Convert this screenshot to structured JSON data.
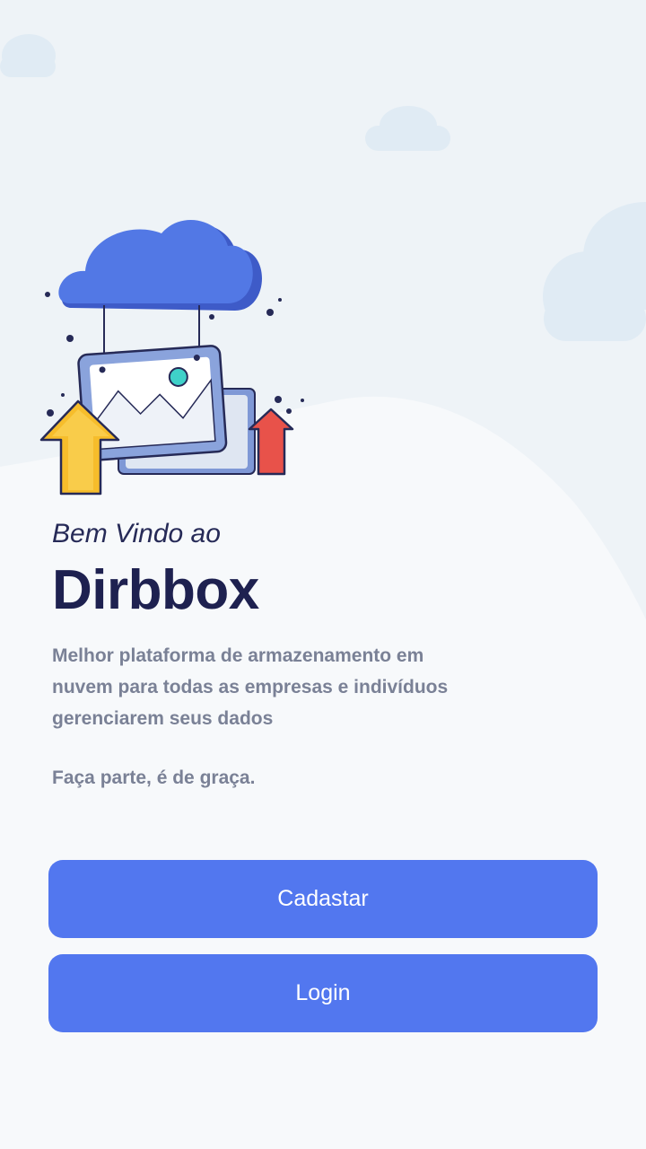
{
  "welcome": {
    "greeting": "Bem Vindo ao",
    "brand": "Dirbbox",
    "description": "Melhor plataforma de armazenamento em nuvem para todas as empresas e indivíduos gerenciarem seus dados",
    "cta_text": "Faça parte, é de graça."
  },
  "actions": {
    "signup_label": "Cadastar",
    "login_label": "Login"
  },
  "colors": {
    "primary": "#5277ef",
    "heading": "#1e2150",
    "body_text": "#7a8196",
    "background": "#f7f9fb",
    "cloud_bg": "#e3edf6"
  },
  "illustration": {
    "icons": [
      "cloud-icon",
      "image-frame-icon",
      "upload-arrow-yellow-icon",
      "upload-arrow-red-icon"
    ]
  }
}
